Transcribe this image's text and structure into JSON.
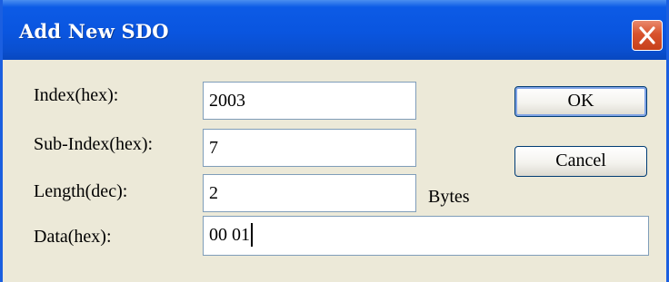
{
  "window": {
    "title": "Add New SDO"
  },
  "form": {
    "index_label": "Index(hex):",
    "index_value": "2003",
    "subindex_label": "Sub-Index(hex):",
    "subindex_value": "7",
    "length_label": "Length(dec):",
    "length_value": "2",
    "length_unit": "Bytes",
    "data_label": "Data(hex):",
    "data_value": "00 01"
  },
  "buttons": {
    "ok_label": "OK",
    "cancel_label": "Cancel"
  },
  "icons": {
    "close": "close-icon"
  },
  "colors": {
    "titlebar": "#0a55df",
    "close_button": "#d8532d",
    "dialog_background": "#ece9d8",
    "field_border": "#7f9db9"
  }
}
